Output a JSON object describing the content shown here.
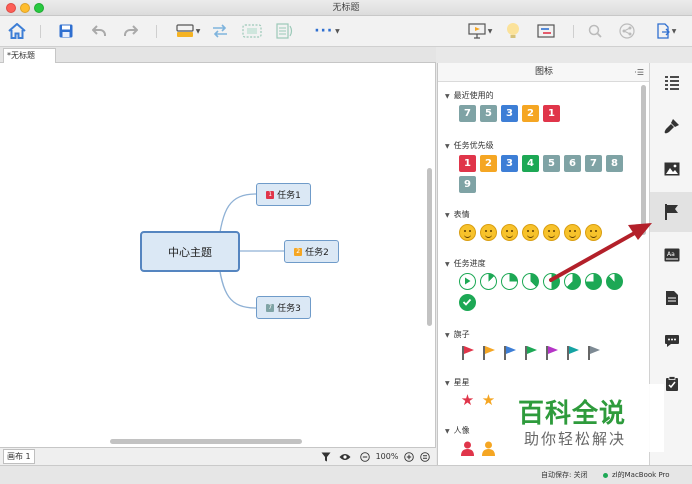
{
  "window": {
    "title": "无标题"
  },
  "tabs": [
    {
      "label": "*无标题"
    }
  ],
  "mindmap": {
    "central": "中心主题",
    "topics": [
      {
        "label": "任务1",
        "priority": "1",
        "priority_color": "#e0354a"
      },
      {
        "label": "任务2",
        "priority": "2",
        "priority_color": "#f5a623"
      },
      {
        "label": "任务3",
        "priority": "7",
        "priority_color": "#7fa3a5"
      }
    ]
  },
  "statusbar": {
    "sheet": "画布 1",
    "zoom": "100%"
  },
  "bottombar": {
    "autosave": "自动保存: 关闭",
    "user": "zl的MacBook Pro"
  },
  "panel": {
    "title": "图标",
    "sections": {
      "recent": {
        "title": "最近使用的",
        "items": [
          {
            "label": "7",
            "color": "#7fa3a5"
          },
          {
            "label": "5",
            "color": "#7fa3a5"
          },
          {
            "label": "3",
            "color": "#3d7ed6"
          },
          {
            "label": "2",
            "color": "#f5a623"
          },
          {
            "label": "1",
            "color": "#e0354a"
          }
        ]
      },
      "priority": {
        "title": "任务优先级",
        "items": [
          {
            "label": "1",
            "color": "#e0354a"
          },
          {
            "label": "2",
            "color": "#f5a623"
          },
          {
            "label": "3",
            "color": "#3d7ed6"
          },
          {
            "label": "4",
            "color": "#1da855"
          },
          {
            "label": "5",
            "color": "#7fa3a5"
          },
          {
            "label": "6",
            "color": "#7fa3a5"
          },
          {
            "label": "7",
            "color": "#7fa3a5"
          },
          {
            "label": "8",
            "color": "#7fa3a5"
          },
          {
            "label": "9",
            "color": "#7fa3a5"
          }
        ]
      },
      "emotion": {
        "title": "表情",
        "count": 7
      },
      "progress": {
        "title": "任务进度",
        "levels": [
          0,
          0.125,
          0.25,
          0.375,
          0.5,
          0.625,
          0.75,
          0.875,
          1
        ]
      },
      "flags": {
        "title": "旗子",
        "colors": [
          "#e0354a",
          "#f5a623",
          "#3d7ed6",
          "#1da855",
          "#b534c7",
          "#14a3a3",
          "#7d8a94"
        ]
      },
      "stars": {
        "title": "星星",
        "colors": [
          "#e0354a",
          "#f5a623"
        ]
      },
      "people": {
        "title": "人像",
        "colors": [
          "#e0354a",
          "#f5a623"
        ]
      }
    }
  },
  "watermark": {
    "line1": "百科全说",
    "line2": "助你轻松解决"
  },
  "colors": {
    "accent": "#5585c0",
    "arrow": "#b3202a",
    "green": "#1da855"
  }
}
